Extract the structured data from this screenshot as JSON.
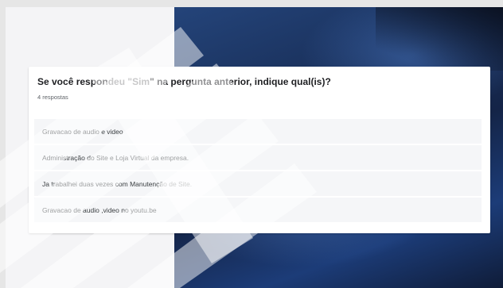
{
  "question": {
    "title": "Se você respondeu \"Sim\" na pergunta anterior, indique qual(is)?",
    "response_count": "4 respostas"
  },
  "answers": [
    "Gravacao de audio e video",
    "Administração do Site e Loja Virtual da empresa.",
    "Ja trabalhei duas vezes com Manutenção de Site.",
    "Gravacao de audio ,video no youtu.be"
  ],
  "colors": {
    "card_background": "#ffffff",
    "answer_background": "#f5f6f8",
    "header_photo": "#1a315c"
  },
  "watermark_icon": "faded-logo-watermark"
}
